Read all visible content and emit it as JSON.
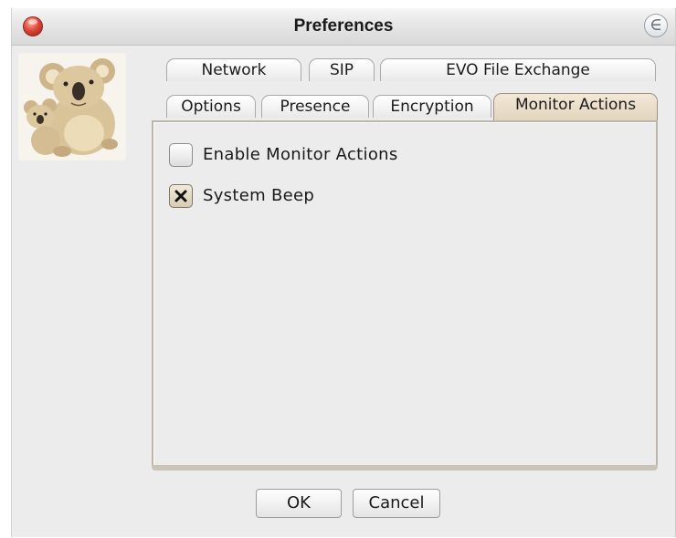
{
  "window": {
    "title": "Preferences"
  },
  "tabs": {
    "row1": [
      {
        "label": "Network"
      },
      {
        "label": "SIP"
      },
      {
        "label": "EVO File Exchange"
      }
    ],
    "row2": [
      {
        "label": "Options"
      },
      {
        "label": "Presence"
      },
      {
        "label": "Encryption"
      },
      {
        "label": "Monitor Actions"
      }
    ],
    "active": "Monitor Actions"
  },
  "monitor_actions": {
    "enable": {
      "label": "Enable Monitor Actions",
      "checked": false
    },
    "system_beep": {
      "label": "System Beep",
      "checked": true
    }
  },
  "footer": {
    "ok_label": "OK",
    "cancel_label": "Cancel"
  },
  "icons": {
    "close": "close-icon",
    "title_right": "e-icon",
    "logo": "koala-logo-icon"
  },
  "colors": {
    "active_tab": "#e6d9c3",
    "close_button": "#e0483a"
  }
}
